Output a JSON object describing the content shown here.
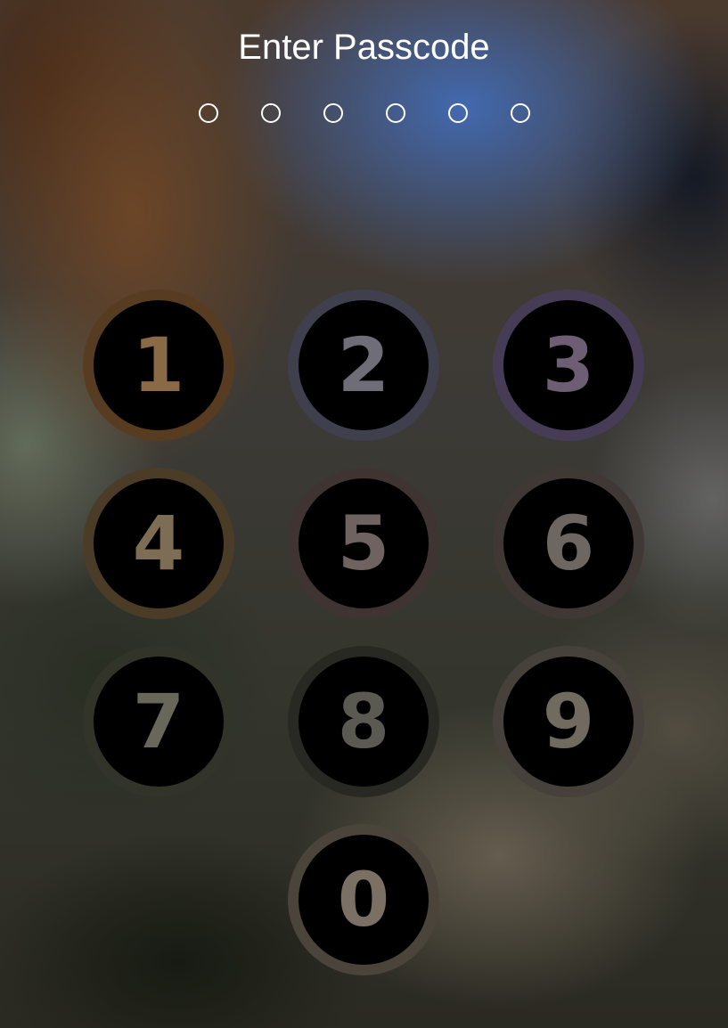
{
  "lock_screen": {
    "title": "Enter Passcode",
    "passcode": {
      "length": 6,
      "entered": 0
    },
    "keypad": {
      "keys": [
        "1",
        "2",
        "3",
        "4",
        "5",
        "6",
        "7",
        "8",
        "9",
        "0"
      ]
    }
  },
  "colors": {
    "title_text": "#ffffff",
    "dot_outline": "#ffffff",
    "key_fill": "#000000"
  }
}
